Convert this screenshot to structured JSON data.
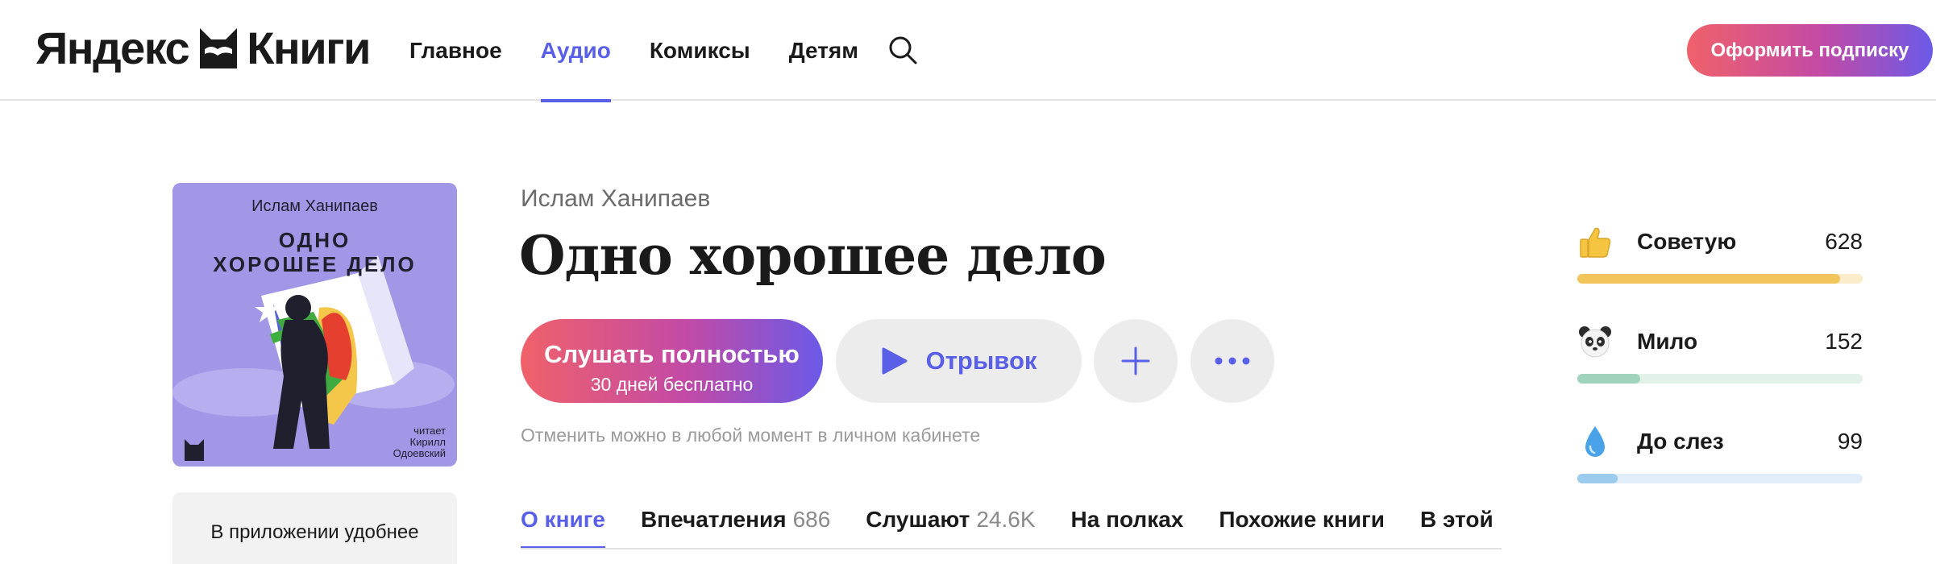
{
  "header": {
    "logo_left": "Яндекс",
    "logo_right": "Книги",
    "nav": [
      {
        "label": "Главное",
        "active": false
      },
      {
        "label": "Аудио",
        "active": true
      },
      {
        "label": "Комиксы",
        "active": false
      },
      {
        "label": "Детям",
        "active": false
      }
    ],
    "search_icon": "search-icon",
    "subscribe_label": "Оформить подписку"
  },
  "cover": {
    "author": "Ислам Ханипаев",
    "title_line1": "ОДНО",
    "title_line2": "ХОРОШЕЕ ДЕЛО",
    "narrator_line1": "читает",
    "narrator_line2": "Кирилл",
    "narrator_line3": "Одоевский"
  },
  "app_box": {
    "label": "В приложении удобнее"
  },
  "book": {
    "author": "Ислам Ханипаев",
    "title": "Одно хорошее дело"
  },
  "actions": {
    "listen_main": "Слушать полностью",
    "listen_sub": "30 дней бесплатно",
    "excerpt": "Отрывок",
    "add_icon": "plus-icon",
    "more_icon": "more-dots-icon",
    "cancel_note": "Отменить можно в любой момент в личном кабинете"
  },
  "tabs": [
    {
      "label": "О книге",
      "count": "",
      "active": true
    },
    {
      "label": "Впечатления",
      "count": "686",
      "active": false
    },
    {
      "label": "Слушают",
      "count": "24.6K",
      "active": false
    },
    {
      "label": "На полках",
      "count": "",
      "active": false
    },
    {
      "label": "Похожие книги",
      "count": "",
      "active": false
    },
    {
      "label": "В этой",
      "count": "",
      "active": false
    }
  ],
  "reactions": [
    {
      "icon": "thumbs-up-icon",
      "label": "Советую",
      "value": "628",
      "fill": 0.92,
      "color": "#f2c55c",
      "track": "#fbeccb"
    },
    {
      "icon": "panda-icon",
      "label": "Мило",
      "value": "152",
      "fill": 0.22,
      "color": "#9fd3bb",
      "track": "#e2f2ea"
    },
    {
      "icon": "droplet-icon",
      "label": "До слез",
      "value": "99",
      "fill": 0.14,
      "color": "#9ccbee",
      "track": "#e1eef9"
    }
  ],
  "colors": {
    "accent": "#5a5fe8",
    "gradient_start": "#f0616a",
    "gradient_end": "#6b5ae8"
  }
}
